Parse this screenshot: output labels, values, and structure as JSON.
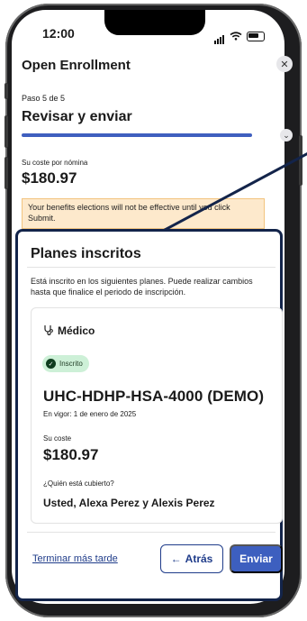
{
  "status_bar": {
    "time": "12:00"
  },
  "header": {
    "title": "Open Enrollment",
    "close_icon": "close-icon"
  },
  "progress": {
    "step_text": "Paso 5 de 5",
    "step_title": "Revisar y enviar",
    "value": 1.0
  },
  "payroll": {
    "label": "Su coste por nómina",
    "value": "$180.97"
  },
  "notice": {
    "text": "Your benefits elections will not be effective until you click Submit."
  },
  "plans": {
    "title": "Planes inscritos",
    "description": "Está inscrito en los siguientes planes. Puede realizar cambios hasta que finalice el periodo de inscripción.",
    "card": {
      "category": "Médico",
      "badge": "Inscrito",
      "plan_name": "UHC-HDHP-HSA-4000 (DEMO)",
      "effective": "En vigor: 1 de enero de 2025",
      "cost_label": "Su coste",
      "cost_value": "$180.97",
      "covered_label": "¿Quién está cubierto?",
      "covered_value": "Usted, Alexa Perez y Alexis Perez"
    }
  },
  "actions": {
    "later": "Terminar más tarde",
    "back": "Atrás",
    "send": "Enviar"
  },
  "colors": {
    "primary": "#3d5fbf",
    "notice_bg": "#fde9cc",
    "badge_bg": "#cdf0d7"
  }
}
